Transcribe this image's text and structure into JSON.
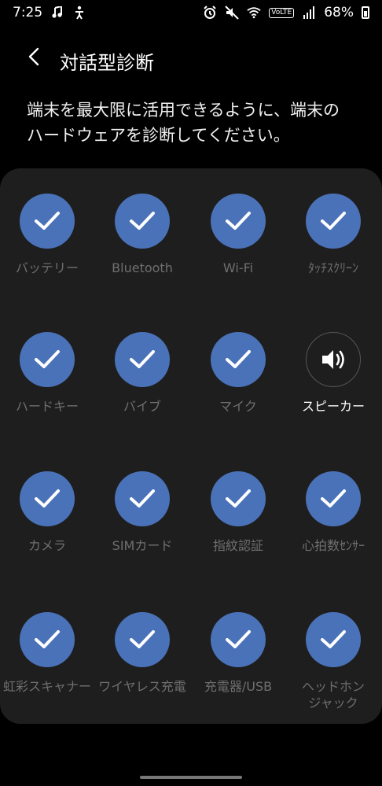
{
  "status_bar": {
    "time": "7:25",
    "volte": "VoLTE",
    "battery": "68%"
  },
  "header": {
    "title": "対話型診断"
  },
  "description": {
    "line1": "端末を最大限に活用できるように、端末の",
    "line2": "ハードウェアを診断してください。"
  },
  "tests": [
    {
      "label": "バッテリー",
      "icon": "battery-icon",
      "status": "done"
    },
    {
      "label": "Bluetooth",
      "icon": "bluetooth-icon",
      "status": "done"
    },
    {
      "label": "Wi-Fi",
      "icon": "wifi-icon",
      "status": "done"
    },
    {
      "label": "ﾀｯﾁｽｸﾘｰﾝ",
      "icon": "touch-icon",
      "status": "done"
    },
    {
      "label": "ハードキー",
      "icon": "hardkey-icon",
      "status": "done"
    },
    {
      "label": "バイブ",
      "icon": "vibration-icon",
      "status": "done"
    },
    {
      "label": "マイク",
      "icon": "microphone-icon",
      "status": "done"
    },
    {
      "label": "スピーカー",
      "icon": "speaker-icon",
      "status": "pending"
    },
    {
      "label": "カメラ",
      "icon": "camera-icon",
      "status": "done"
    },
    {
      "label": "SIMカード",
      "icon": "sim-card-icon",
      "status": "done"
    },
    {
      "label": "指紋認証",
      "icon": "fingerprint-icon",
      "status": "done"
    },
    {
      "label": "心拍数ｾﾝｻｰ",
      "icon": "heart-rate-icon",
      "status": "done"
    },
    {
      "label": "虹彩スキャナー",
      "icon": "iris-icon",
      "status": "done"
    },
    {
      "label": "ワイヤレス充電",
      "icon": "wireless-charging-icon",
      "status": "done"
    },
    {
      "label": "充電器/USB",
      "icon": "usb-icon",
      "status": "done"
    },
    {
      "label": "ヘッドホン",
      "label2": "ジャック",
      "icon": "headphone-icon",
      "status": "done"
    }
  ],
  "colors": {
    "accent": "#4a72b8",
    "panel": "#1e1e1e",
    "muted_label": "#6f6f6f"
  }
}
